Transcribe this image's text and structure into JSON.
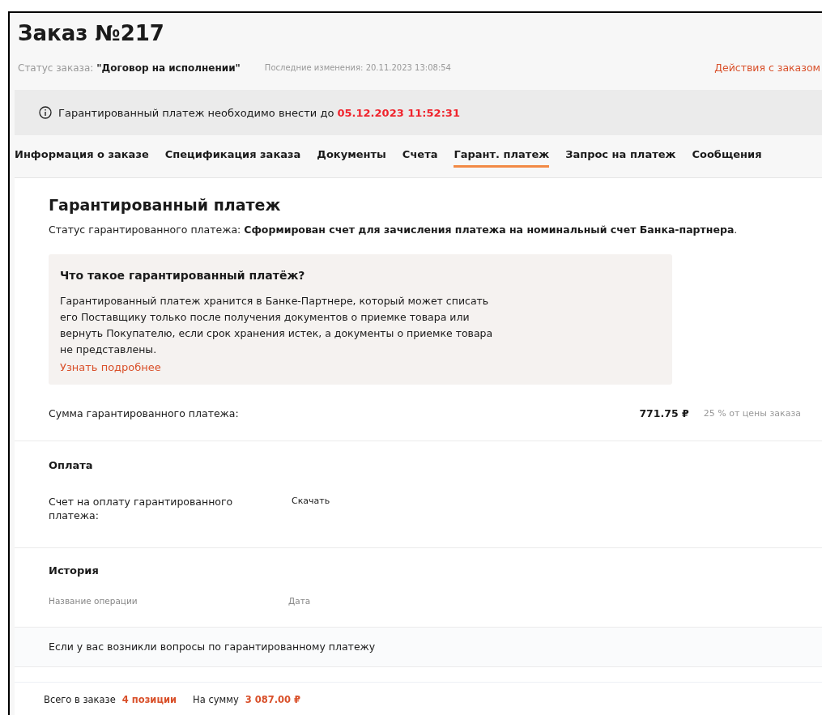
{
  "order": {
    "title": "Заказ №217",
    "status_label": "Статус заказа:",
    "status_value": "\"Договор на исполнении\"",
    "last_changed": "Последние изменения: 20.11.2023 13:08:54",
    "actions_link": "Действия с заказом"
  },
  "alert": {
    "text": "Гарантированный платеж необходимо внести до",
    "deadline": "05.12.2023 11:52:31"
  },
  "tabs": [
    {
      "label": "Информация о заказе",
      "selected": false
    },
    {
      "label": "Спецификация заказа",
      "selected": false
    },
    {
      "label": "Документы",
      "selected": false
    },
    {
      "label": "Счета",
      "selected": false
    },
    {
      "label": "Гарант. платеж",
      "selected": true
    },
    {
      "label": "Запрос на платеж",
      "selected": false
    },
    {
      "label": "Сообщения",
      "selected": false
    }
  ],
  "guarantee": {
    "title": "Гарантированный платеж",
    "status": "Статус гарантированного платежа: **Сформирован счет для зачисления платежа на номинальный счет Банка-партнера**.",
    "info": {
      "title": "Что такое гарантированный платёж?",
      "text": "Гарантированный платеж хранится в Банке-Партнере, который может списать его Поставщику только после получения документов о приемке товара или вернуть Покупателю, если срок хранения истек, а документы о приемке товара не представлены.",
      "link": "Узнать подробнее"
    },
    "amount_label": "Сумма гарантированного платежа:",
    "amount": "771.75 ₽",
    "amount_share": "25 % от цены заказа"
  },
  "payment": {
    "title": "Оплата",
    "invoice_label": "Счет на оплату гарантированного платежа:",
    "download": "Скачать"
  },
  "history": {
    "title": "История",
    "columns": [
      "Название операции",
      "Дата"
    ]
  },
  "questions": "Если у вас возникли вопросы по гарантированному платежу",
  "footer": {
    "total_label": "Всего в заказе",
    "total_value": "4 позиции",
    "sum_label": "На сумму",
    "sum_value": "3 087.00 ₽"
  }
}
